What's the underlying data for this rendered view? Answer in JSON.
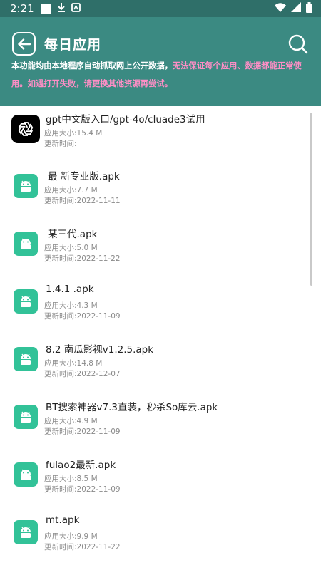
{
  "status_bar": {
    "time": "2:21",
    "icons": [
      "square-notification-icon",
      "download-icon",
      "app-notification-icon",
      "wifi-icon",
      "signal-icon",
      "battery-icon"
    ]
  },
  "header": {
    "title": "每日应用",
    "notice_prefix": "本功能均由本地程序自动抓取网上公开数据，",
    "notice_warning": "无法保证每个应用、数据都能正常使用。如遇打开失败，请更换其他资源再尝试。",
    "back_icon": "back-arrow-icon",
    "search_icon": "search-icon"
  },
  "colors": {
    "header_bg": "#3b8a82",
    "status_bg": "#2f6f69",
    "warning_text": "#ff8ec6",
    "android_icon_bg": "#32c298"
  },
  "apps": [
    {
      "name": "gpt中文版入口/gpt-4o/cluade3试用",
      "size": "应用大小:15.4 M",
      "updated": "更新时间:",
      "icon": "openai-icon"
    },
    {
      "name": "最 新专业版.apk",
      "size": "应用大小:7.7 M",
      "updated": "更新时间:2022-11-11",
      "icon": "android-icon"
    },
    {
      "name": "某三代.apk",
      "size": "应用大小:5.0 M",
      "updated": "更新时间:2022-11-22",
      "icon": "android-icon"
    },
    {
      "name": "1.4.1 .apk",
      "size": "应用大小:4.3 M",
      "updated": "更新时间:2022-11-09",
      "icon": "android-icon"
    },
    {
      "name": "8.2  南瓜影视v1.2.5.apk",
      "size": "应用大小:14.8 M",
      "updated": "更新时间:2022-12-07",
      "icon": "android-icon"
    },
    {
      "name": "BT搜索神器v7.3直装，秒杀So库云.apk",
      "size": "应用大小:4.9 M",
      "updated": "更新时间:2022-11-09",
      "icon": "android-icon"
    },
    {
      "name": "fulao2最新.apk",
      "size": "应用大小:8.5 M",
      "updated": "更新时间:2022-11-09",
      "icon": "android-icon"
    },
    {
      "name": "mt.apk",
      "size": "应用大小:9.9 M",
      "updated": "更新时间:2022-11-22",
      "icon": "android-icon"
    }
  ]
}
